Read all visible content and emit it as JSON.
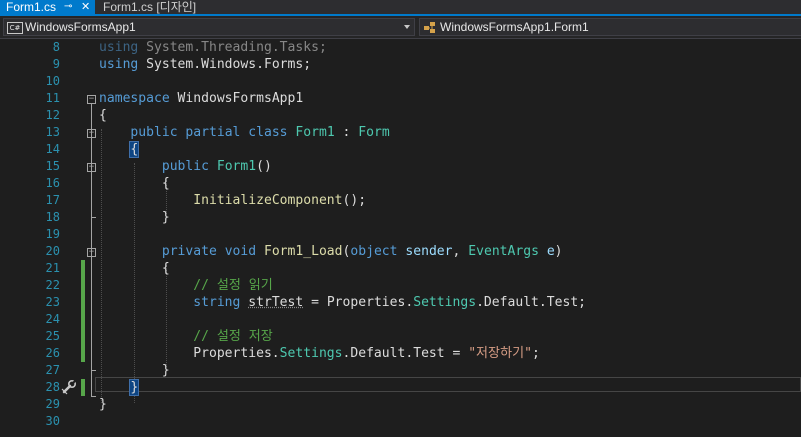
{
  "tabs": [
    {
      "label": "Form1.cs",
      "pin_icon": "pin-icon",
      "close_icon": "close-icon",
      "active": true
    },
    {
      "label": "Form1.cs [디자인]",
      "active": false
    }
  ],
  "navbar": {
    "project": "WindowsFormsApp1",
    "project_icon_text": "C#",
    "type": "WindowsFormsApp1.Form1"
  },
  "editor": {
    "line_numbers": [
      "8",
      "9",
      "10",
      "11",
      "12",
      "13",
      "14",
      "15",
      "16",
      "17",
      "18",
      "19",
      "20",
      "21",
      "22",
      "23",
      "24",
      "25",
      "26",
      "27",
      "28",
      "29",
      "30"
    ],
    "lines": [
      {
        "n": "8",
        "tokens": [
          [
            "kw",
            "using"
          ],
          [
            "nsp",
            " System.Threading.Tasks;"
          ]
        ],
        "faded": true
      },
      {
        "n": "9",
        "tokens": [
          [
            "kw",
            "using"
          ],
          [
            "nsp",
            " System.Windows.Forms;"
          ]
        ]
      },
      {
        "n": "10",
        "tokens": []
      },
      {
        "n": "11",
        "tokens": [
          [
            "kw",
            "namespace"
          ],
          [
            "nsp",
            " WindowsFormsApp1"
          ]
        ]
      },
      {
        "n": "12",
        "tokens": [
          [
            "nsp",
            "{"
          ]
        ]
      },
      {
        "n": "13",
        "tokens": [
          [
            "nsp",
            "    "
          ],
          [
            "kw",
            "public"
          ],
          [
            "nsp",
            " "
          ],
          [
            "kw",
            "partial"
          ],
          [
            "nsp",
            " "
          ],
          [
            "kw",
            "class"
          ],
          [
            "nsp",
            " "
          ],
          [
            "ty",
            "Form1"
          ],
          [
            "nsp",
            " : "
          ],
          [
            "ty",
            "Form"
          ]
        ]
      },
      {
        "n": "14",
        "tokens": [
          [
            "nsp",
            "    "
          ],
          [
            "hi",
            "{"
          ]
        ]
      },
      {
        "n": "15",
        "tokens": [
          [
            "nsp",
            "        "
          ],
          [
            "kw",
            "public"
          ],
          [
            "nsp",
            " "
          ],
          [
            "ty",
            "Form1"
          ],
          [
            "nsp",
            "()"
          ]
        ]
      },
      {
        "n": "16",
        "tokens": [
          [
            "nsp",
            "        {"
          ]
        ]
      },
      {
        "n": "17",
        "tokens": [
          [
            "nsp",
            "            "
          ],
          [
            "mt",
            "InitializeComponent"
          ],
          [
            "nsp",
            "();"
          ]
        ]
      },
      {
        "n": "18",
        "tokens": [
          [
            "nsp",
            "        }"
          ]
        ]
      },
      {
        "n": "19",
        "tokens": []
      },
      {
        "n": "20",
        "tokens": [
          [
            "nsp",
            "        "
          ],
          [
            "kw",
            "private"
          ],
          [
            "nsp",
            " "
          ],
          [
            "kw",
            "void"
          ],
          [
            "nsp",
            " "
          ],
          [
            "mt",
            "Form1_Load"
          ],
          [
            "nsp",
            "("
          ],
          [
            "kw",
            "object"
          ],
          [
            "nsp",
            " "
          ],
          [
            "pa",
            "sender"
          ],
          [
            "nsp",
            ", "
          ],
          [
            "ty",
            "EventArgs"
          ],
          [
            "nsp",
            " "
          ],
          [
            "pa",
            "e"
          ],
          [
            "nsp",
            ")"
          ]
        ]
      },
      {
        "n": "21",
        "tokens": [
          [
            "nsp",
            "        {"
          ]
        ]
      },
      {
        "n": "22",
        "tokens": [
          [
            "nsp",
            "            "
          ],
          [
            "cm",
            "// 설정 읽기"
          ]
        ]
      },
      {
        "n": "23",
        "tokens": [
          [
            "nsp",
            "            "
          ],
          [
            "kw",
            "string"
          ],
          [
            "nsp",
            " "
          ],
          [
            "sq",
            "strTest"
          ],
          [
            "nsp",
            " = Properties."
          ],
          [
            "ty",
            "Settings"
          ],
          [
            "nsp",
            ".Default.Test;"
          ]
        ]
      },
      {
        "n": "24",
        "tokens": []
      },
      {
        "n": "25",
        "tokens": [
          [
            "nsp",
            "            "
          ],
          [
            "cm",
            "// 설정 저장"
          ]
        ]
      },
      {
        "n": "26",
        "tokens": [
          [
            "nsp",
            "            Properties."
          ],
          [
            "ty",
            "Settings"
          ],
          [
            "nsp",
            ".Default.Test = "
          ],
          [
            "st",
            "\"저장하기\""
          ],
          [
            "nsp",
            ";"
          ]
        ]
      },
      {
        "n": "27",
        "tokens": [
          [
            "nsp",
            "        }"
          ]
        ]
      },
      {
        "n": "28",
        "tokens": [
          [
            "nsp",
            "    "
          ],
          [
            "hi",
            "}"
          ]
        ]
      },
      {
        "n": "29",
        "tokens": [
          [
            "nsp",
            "}"
          ]
        ]
      },
      {
        "n": "30",
        "tokens": []
      }
    ],
    "colors": {
      "keyword": "#569cd6",
      "type": "#4ec9b0",
      "method": "#dcdcaa",
      "parameter": "#9cdcfe",
      "comment": "#57a64a",
      "string": "#d69d85",
      "line_number": "#2b91af",
      "accent": "#007acc"
    },
    "margin_icon": "wrench-icon"
  }
}
